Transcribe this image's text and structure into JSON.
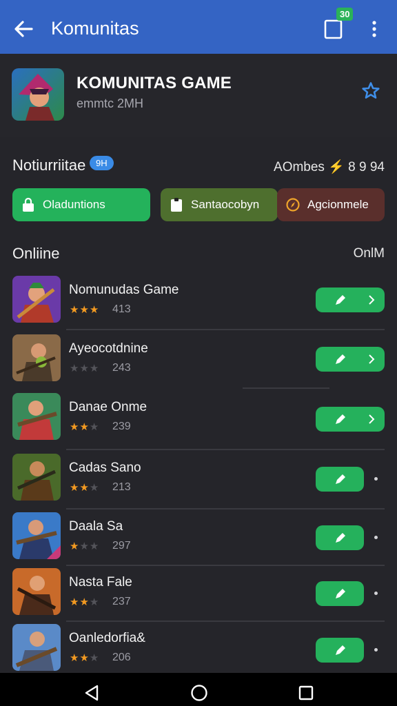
{
  "app_bar": {
    "title": "Komunitas",
    "cart_badge": "30",
    "back_icon": "arrow-left-icon",
    "cart_icon": "cart-icon",
    "more_icon": "more-vertical-icon",
    "color": "#3464c4"
  },
  "header": {
    "title": "KOMUNITAS GAME",
    "subtitle": "emmtc 2MH",
    "favorite_icon": "star-outline-icon"
  },
  "notifications": {
    "title": "Notiurriitae",
    "badge": "9H",
    "right_text": "AOmbes",
    "right_bolt": "⚡",
    "right_value": "8 9 94"
  },
  "chips": [
    {
      "label": "Oladuntions",
      "icon": "lock-icon",
      "color": "#24b25b"
    },
    {
      "label": "Santaocobyn",
      "icon": "clipboard-icon",
      "color": "#4e6f2e"
    },
    {
      "label": "Agcionmele",
      "icon": "compass-icon",
      "color": "#5a2f2c"
    }
  ],
  "section": {
    "left": "Onliine",
    "right": "OnlM"
  },
  "games": [
    {
      "name": "Nomunudas Game",
      "rating": 3,
      "count": "413",
      "action": "play-chevron"
    },
    {
      "name": "Ayeocotdnine",
      "rating": 0,
      "count": "243",
      "action": "play-chevron"
    },
    {
      "name": "Danae Onme",
      "rating": 2,
      "count": "239",
      "action": "play-chevron"
    },
    {
      "name": "Cadas Sano",
      "rating": 2,
      "count": "213",
      "action": "play-dot"
    },
    {
      "name": "Daala Sa",
      "rating": 1,
      "count": "297",
      "action": "play-dot"
    },
    {
      "name": "Nasta Fale",
      "rating": 2,
      "count": "237",
      "action": "play-dot"
    },
    {
      "name": "Oanledorfia&",
      "rating": 2,
      "count": "206",
      "action": "play-dot"
    }
  ],
  "nav": {
    "back_icon": "triangle-back-icon",
    "home_icon": "circle-home-icon",
    "recent_icon": "square-recents-icon"
  }
}
